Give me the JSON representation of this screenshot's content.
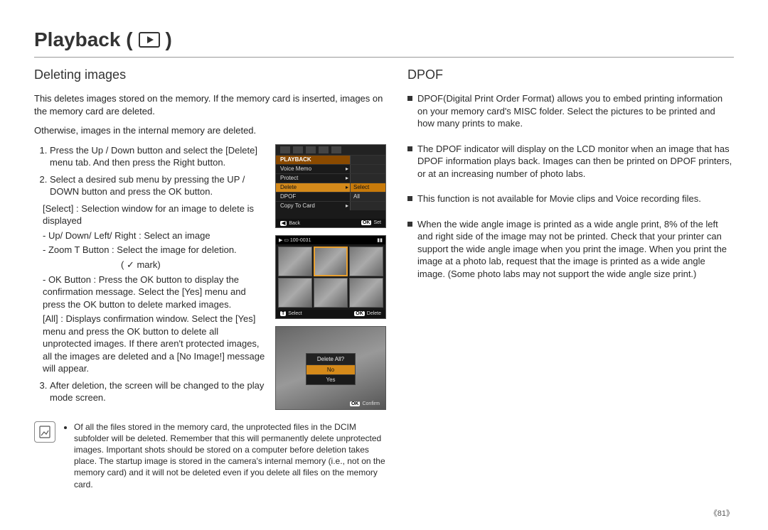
{
  "page_title": "Playback (",
  "page_title_end": ")",
  "left": {
    "heading": "Deleting images",
    "intro1": "This deletes images stored on the memory. If the memory card is inserted, images on the memory card are deleted.",
    "intro2": "Otherwise, images in the internal memory are deleted.",
    "step1": "Press the Up / Down button and select the [Delete] menu tab. And then press the Right button.",
    "step2": "Select a desired sub menu by pressing the UP / DOWN button and press the OK button.",
    "sub_select": "[Select] : Selection window for an image to delete is displayed",
    "sub_updown": "- Up/ Down/ Left/ Right : Select an image",
    "sub_zoom": "- Zoom T Button : Select the image for deletion.",
    "sub_mark": "( ✓ mark)",
    "sub_ok": "- OK Button : Press the OK button to display the confirmation message. Select the [Yes] menu and press the OK button to delete marked images.",
    "sub_all": "[All] : Displays confirmation window. Select the [Yes] menu and press the OK button to delete all unprotected images. If there aren't protected images, all the images are deleted and a [No Image!] message will appear.",
    "step3": "After deletion, the screen will be changed to the play mode screen.",
    "note": "Of all the files stored in the memory card, the unprotected files in the DCIM subfolder will be deleted. Remember that this will permanently delete unprotected images. Important shots should be stored on a computer before deletion takes place. The startup image is stored in the camera's internal memory (i.e., not on the memory card) and it will not be deleted even if you delete all files on the memory card."
  },
  "right": {
    "heading": "DPOF",
    "b1": "DPOF(Digital Print Order Format) allows you to embed printing information on your memory card's MISC folder. Select the pictures to be printed and how many prints to make.",
    "b2": "The DPOF indicator will display on the LCD monitor when an image that has DPOF information plays back. Images can then be printed on DPOF printers, or at an increasing number of photo labs.",
    "b3": "This function is not available for Movie clips and Voice recording files.",
    "b4": "When the wide angle image is printed as a wide angle print, 8% of the left and right side of the image may not be printed. Check that your printer can support the wide angle image when you print the image. When you print the image at a photo lab, request that the image is printed as a wide angle image. (Some photo labs may not support the wide angle size print.)"
  },
  "shot1": {
    "header": "PLAYBACK",
    "r1": "Voice Memo",
    "r2": "Protect",
    "r3": "Delete",
    "r3b": "Select",
    "r4": "DPOF",
    "r4b": "All",
    "r5": "Copy To Card",
    "back": "Back",
    "set": "Set"
  },
  "shot2": {
    "counter": "100-0031",
    "select": "Select",
    "delete": "Delete"
  },
  "shot3": {
    "title": "Delete All?",
    "no": "No",
    "yes": "Yes",
    "confirm": "Confirm"
  },
  "page_number": "《81》"
}
